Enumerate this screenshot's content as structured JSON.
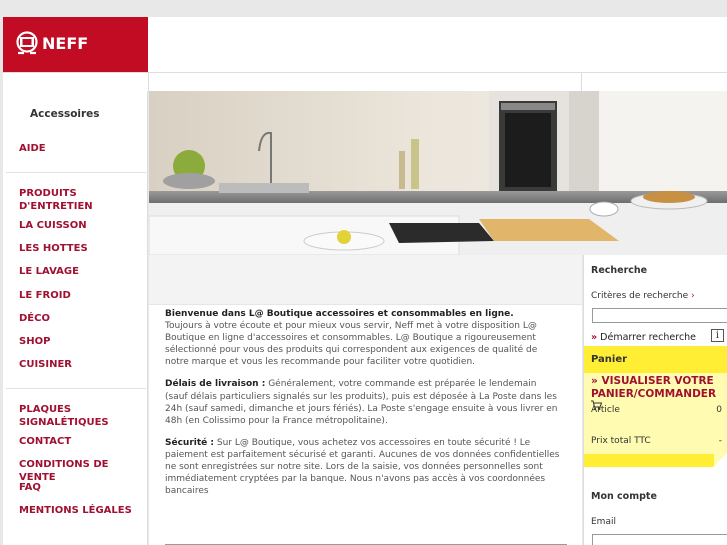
{
  "brand": {
    "logo_text": "NEFF",
    "color": "#c20c24"
  },
  "sidebar": {
    "title": "Accessoires",
    "items": [
      {
        "label": "AIDE"
      },
      {
        "label": "PRODUITS\nD'ENTRETIEN"
      },
      {
        "label": "LA CUISSON"
      },
      {
        "label": "LES HOTTES"
      },
      {
        "label": "LE LAVAGE"
      },
      {
        "label": "LE FROID"
      },
      {
        "label": "DÉCO"
      },
      {
        "label": "SHOP"
      },
      {
        "label": "CUISINER"
      },
      {
        "label": "PLAQUES\nSIGNALÉTIQUES"
      },
      {
        "label": "CONTACT"
      },
      {
        "label": "CONDITIONS DE VENTE"
      },
      {
        "label": "FAQ"
      },
      {
        "label": "MENTIONS LÉGALES"
      }
    ]
  },
  "hero": {
    "image": "kitchen-photo"
  },
  "main": {
    "welcome_title": "Bienvenue dans L@ Boutique accessoires et consommables en ligne.",
    "welcome_text": "Toujours à votre écoute et pour mieux vous servir, Neff met à votre disposition L@ Boutique en ligne d'accessoires et consommables. L@ Boutique a rigoureusement sélectionné pour vous des produits qui correspondent aux exigences de qualité de notre marque et vous les recommande pour faciliter votre quotidien.",
    "delivery_title": "Délais de livraison :",
    "delivery_text": "Généralement, votre commande est préparée  le lendemain (sauf délais particuliers signalés sur les produits), puis est déposée à La Poste dans les 24h (sauf samedi, dimanche et jours fériés). La Poste s'engage ensuite à vous livrer en 48h (en Colissimo pour la France métropolitaine).",
    "security_title": "Sécurité :",
    "security_text": "Sur L@ Boutique, vous achetez vos accessoires en toute sécurité ! Le paiement est parfaitement sécurisé et garanti. Aucunes de vos données confidentielles ne sont enregistrées sur notre site. Lors de la saisie, vos données personnelles sont immédiatement cryptées par la banque. Nous n'avons pas accès à vos coordonnées bancaires"
  },
  "search": {
    "title": "Recherche",
    "criteria_label": "Critères de recherche",
    "input_value": "",
    "start_label": "Démarrer recherche",
    "arrow": "»",
    "info_glyph": "i"
  },
  "cart": {
    "title": "Panier",
    "link_label": "» VISUALISER VOTRE PANIER/COMMANDER",
    "article_label": "Article",
    "article_value": "0",
    "total_label": "Prix total TTC",
    "total_value": "-"
  },
  "account": {
    "title": "Mon compte",
    "email_label": "Email",
    "email_value": ""
  }
}
